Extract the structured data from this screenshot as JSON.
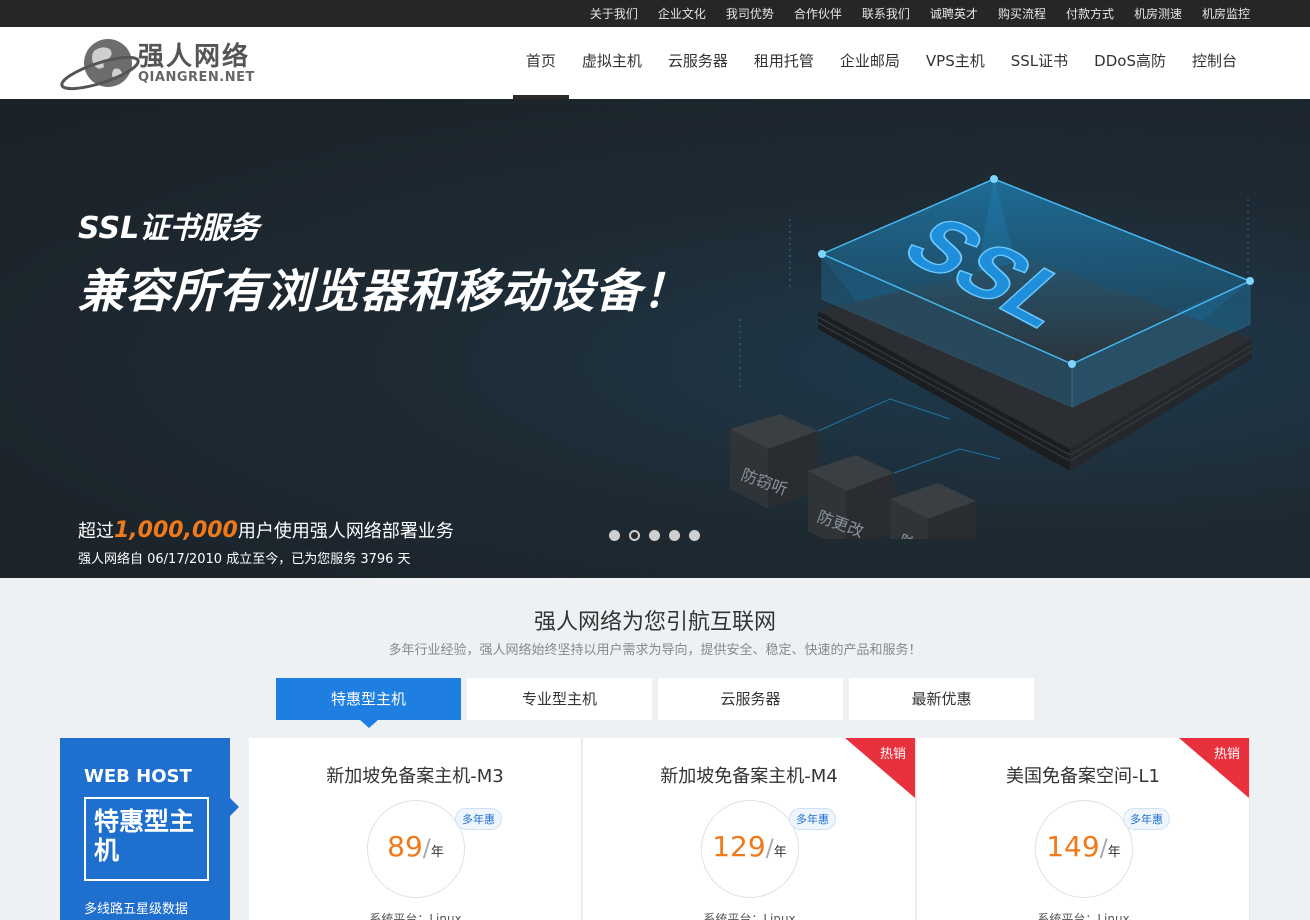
{
  "topbar": {
    "links": [
      "关于我们",
      "企业文化",
      "我司优势",
      "合作伙伴",
      "联系我们",
      "诚聘英才",
      "购买流程",
      "付款方式",
      "机房测速",
      "机房监控"
    ]
  },
  "header": {
    "logo_cn": "强人网络",
    "logo_en": "QIANGREN.NET",
    "nav": [
      "首页",
      "虚拟主机",
      "云服务器",
      "租用托管",
      "企业邮局",
      "VPS主机",
      "SSL证书",
      "DDoS高防",
      "控制台"
    ],
    "active_nav": "首页"
  },
  "hero": {
    "subtitle": "SSL证书服务",
    "title": "兼容所有浏览器和移动设备！",
    "stat_prefix": "超过",
    "stat_number": "1,000,000",
    "stat_suffix": "用户使用强人网络部署业务",
    "since_text": "强人网络自 06/17/2010 成立至今，已为您服务 3796 天",
    "illustration": {
      "main_label": "SSL",
      "box_labels": [
        "防窃听",
        "防更改",
        "防冒充"
      ],
      "accent_color": "#1fa3e8"
    },
    "slide_count": 5,
    "active_slide": 2
  },
  "section": {
    "title": "强人网络为您引航互联网",
    "description": "多年行业经验，强人网络始终坚持以用户需求为导向，提供安全、稳定、快速的产品和服务！"
  },
  "tabs": {
    "items": [
      "特惠型主机",
      "专业型主机",
      "云服务器",
      "最新优惠"
    ],
    "active": "特惠型主机"
  },
  "side_card": {
    "en_title": "WEB HOST",
    "cn_title": "特惠型主机",
    "description": "多线路五星级数据"
  },
  "products": [
    {
      "name": "新加坡免备案主机-M3",
      "price": "89",
      "sep": "/",
      "unit": "年",
      "badge": "多年惠",
      "ribbon": "",
      "platform": "系统平台：Linux"
    },
    {
      "name": "新加坡免备案主机-M4",
      "price": "129",
      "sep": "/",
      "unit": "年",
      "badge": "多年惠",
      "ribbon": "热销",
      "platform": "系统平台：Linux"
    },
    {
      "name": "美国免备案空间-L1",
      "price": "149",
      "sep": "/",
      "unit": "年",
      "badge": "多年惠",
      "ribbon": "热销",
      "platform": "系统平台：Linux"
    }
  ],
  "colors": {
    "brand_blue": "#1f7fe0",
    "accent_orange": "#f07a1a",
    "ribbon_red": "#e8313d"
  }
}
